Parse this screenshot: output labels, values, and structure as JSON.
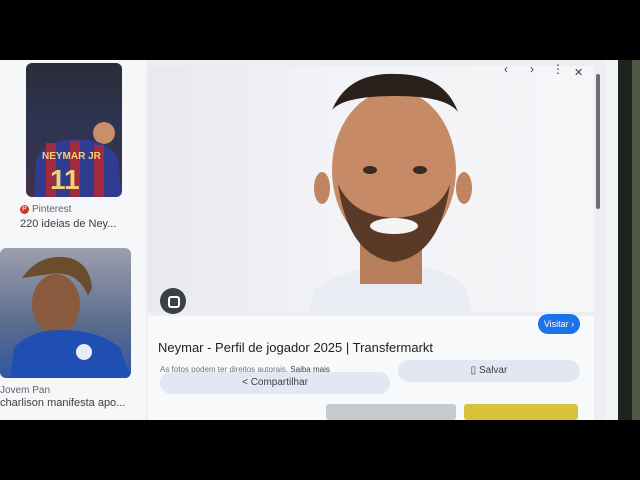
{
  "left_results": [
    {
      "source": "Pinterest",
      "title": "220 ideias de Ney..."
    },
    {
      "source": "Jovem Pan",
      "title": "charlison manifesta apo..."
    }
  ],
  "preview": {
    "title": "Neymar - Perfil de jogador 2025 | Transfermarkt",
    "visit_label": "Visitar",
    "copyright_note": "As fotos podem ter direitos autorais.",
    "learn_more": "Saiba mais",
    "share_label": "Compartilhar",
    "save_label": "Salvar",
    "nav": {
      "prev": "‹",
      "next": "›",
      "more": "⋮",
      "close": "✕"
    }
  },
  "thumbnail_text": {
    "shirt": "NEYMAR JR",
    "number": "11"
  }
}
